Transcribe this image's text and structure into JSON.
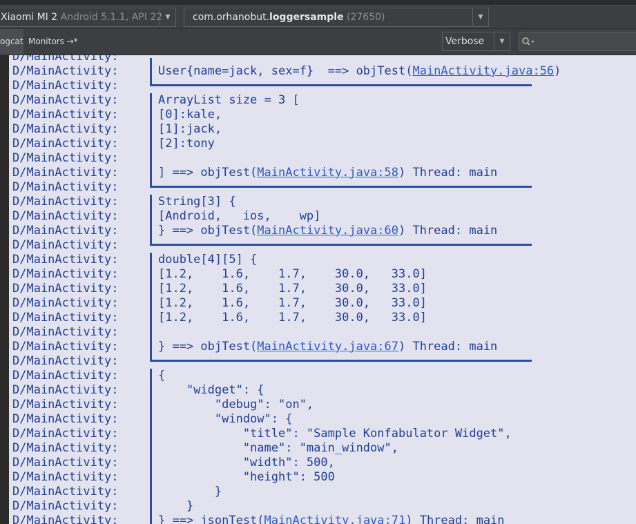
{
  "toolbar": {
    "device_name": "Xiaomi MI 2",
    "device_info": "Android 5.1.1, API 22",
    "process_prefix": "com.orhanobut.",
    "process_bold": "loggersample",
    "process_pid": "(27650)",
    "log_level": "Verbose"
  },
  "tabs": [
    {
      "label": "ogcat"
    },
    {
      "label": "Monitors →*"
    }
  ],
  "colors": {
    "log_background": "#e3e3ef",
    "log_text": "#1f3f95",
    "link": "#2e5bbf",
    "frame": "#2b4ea0"
  },
  "log": {
    "tag": "D/MainActivity:",
    "lines": [
      {
        "kind": "top"
      },
      {
        "kind": "text",
        "segments": [
          {
            "t": "User{name=jack, sex=f}  ==> objTest("
          },
          {
            "t": "MainActivity.java:56",
            "link": true
          },
          {
            "t": ")"
          }
        ]
      },
      {
        "kind": "bottom"
      },
      {
        "kind": "text",
        "segments": [
          {
            "t": "ArrayList size = 3 ["
          }
        ]
      },
      {
        "kind": "text",
        "segments": [
          {
            "t": "[0]:kale,"
          }
        ]
      },
      {
        "kind": "text",
        "segments": [
          {
            "t": "[1]:jack,"
          }
        ]
      },
      {
        "kind": "text",
        "segments": [
          {
            "t": "[2]:tony"
          }
        ]
      },
      {
        "kind": "text",
        "segments": [
          {
            "t": ""
          }
        ]
      },
      {
        "kind": "text",
        "segments": [
          {
            "t": "] ==> objTest("
          },
          {
            "t": "MainActivity.java:58",
            "link": true
          },
          {
            "t": ") Thread: main"
          }
        ]
      },
      {
        "kind": "bottom"
      },
      {
        "kind": "text",
        "segments": [
          {
            "t": "String[3] {"
          }
        ]
      },
      {
        "kind": "text",
        "segments": [
          {
            "t": "[Android,   ios,    wp]"
          }
        ]
      },
      {
        "kind": "text",
        "segments": [
          {
            "t": "} ==> objTest("
          },
          {
            "t": "MainActivity.java:60",
            "link": true
          },
          {
            "t": ") Thread: main"
          }
        ]
      },
      {
        "kind": "bottom"
      },
      {
        "kind": "text",
        "segments": [
          {
            "t": "double[4][5] {"
          }
        ]
      },
      {
        "kind": "text",
        "segments": [
          {
            "t": "[1.2,    1.6,    1.7,    30.0,   33.0]"
          }
        ]
      },
      {
        "kind": "text",
        "segments": [
          {
            "t": "[1.2,    1.6,    1.7,    30.0,   33.0]"
          }
        ]
      },
      {
        "kind": "text",
        "segments": [
          {
            "t": "[1.2,    1.6,    1.7,    30.0,   33.0]"
          }
        ]
      },
      {
        "kind": "text",
        "segments": [
          {
            "t": "[1.2,    1.6,    1.7,    30.0,   33.0]"
          }
        ]
      },
      {
        "kind": "text",
        "segments": [
          {
            "t": ""
          }
        ]
      },
      {
        "kind": "text",
        "segments": [
          {
            "t": "} ==> objTest("
          },
          {
            "t": "MainActivity.java:67",
            "link": true
          },
          {
            "t": ") Thread: main"
          }
        ]
      },
      {
        "kind": "bottom"
      },
      {
        "kind": "text",
        "segments": [
          {
            "t": "{"
          }
        ]
      },
      {
        "kind": "text",
        "segments": [
          {
            "t": "    \"widget\": {"
          }
        ]
      },
      {
        "kind": "text",
        "segments": [
          {
            "t": "        \"debug\": \"on\","
          }
        ]
      },
      {
        "kind": "text",
        "segments": [
          {
            "t": "        \"window\": {"
          }
        ]
      },
      {
        "kind": "text",
        "segments": [
          {
            "t": "            \"title\": \"Sample Konfabulator Widget\","
          }
        ]
      },
      {
        "kind": "text",
        "segments": [
          {
            "t": "            \"name\": \"main_window\","
          }
        ]
      },
      {
        "kind": "text",
        "segments": [
          {
            "t": "            \"width\": 500,"
          }
        ]
      },
      {
        "kind": "text",
        "segments": [
          {
            "t": "            \"height\": 500"
          }
        ]
      },
      {
        "kind": "text",
        "segments": [
          {
            "t": "        }"
          }
        ]
      },
      {
        "kind": "text",
        "segments": [
          {
            "t": "    }"
          }
        ]
      },
      {
        "kind": "text",
        "segments": [
          {
            "t": "} ==> jsonTest("
          },
          {
            "t": "MainActivity.java:71",
            "link": true
          },
          {
            "t": ") Thread: main"
          }
        ]
      }
    ]
  }
}
